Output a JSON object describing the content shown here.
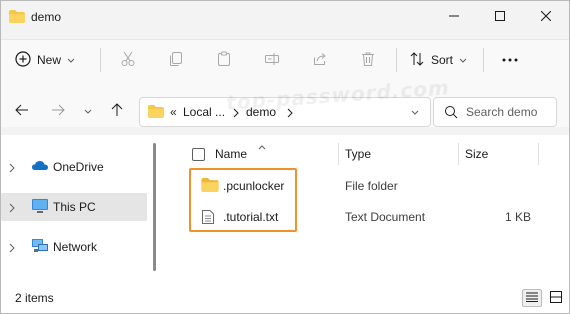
{
  "window": {
    "title": "demo",
    "minimize_icon": "minimize-icon",
    "maximize_icon": "maximize-icon",
    "close_icon": "close-icon"
  },
  "command_bar": {
    "new_label": "New",
    "sort_label": "Sort",
    "icons": [
      "plus-circle-icon",
      "cut-icon",
      "copy-icon",
      "paste-icon",
      "rename-icon",
      "share-icon",
      "delete-icon",
      "sort-icon",
      "more-icon"
    ]
  },
  "address": {
    "overflow": "«",
    "crumbs": [
      "Local ...",
      "demo"
    ],
    "search_placeholder": "Search demo"
  },
  "nav": {
    "items": [
      {
        "label": "OneDrive",
        "icon": "cloud-icon",
        "selected": false
      },
      {
        "label": "This PC",
        "icon": "computer-icon",
        "selected": true
      },
      {
        "label": "Network",
        "icon": "network-icon",
        "selected": false
      }
    ]
  },
  "files": {
    "columns": {
      "name": "Name",
      "type": "Type",
      "size": "Size"
    },
    "rows": [
      {
        "name": ".pcunlocker",
        "type": "File folder",
        "size": "",
        "icon": "folder-icon"
      },
      {
        "name": ".tutorial.txt",
        "type": "Text Document",
        "size": "1 KB",
        "icon": "text-file-icon"
      }
    ]
  },
  "status": {
    "item_count": "2 items"
  },
  "watermark": "top-password.com",
  "colors": {
    "highlight": "#f0912e",
    "folder": "#f7c74a",
    "selected_nav": "#e5e5e5"
  }
}
